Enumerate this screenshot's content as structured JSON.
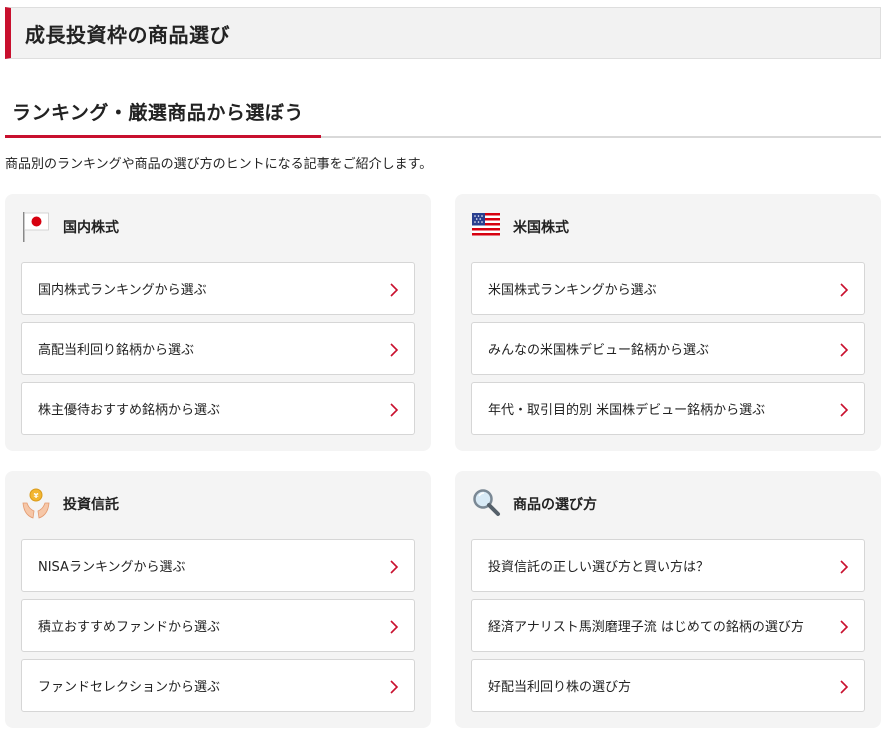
{
  "page_title": "成長投資枠の商品選び",
  "section": {
    "heading": "ランキング・厳選商品から選ぼう",
    "intro": "商品別のランキングや商品の選び方のヒントになる記事をご紹介します。"
  },
  "colors": {
    "accent": "#c8102e",
    "card_bg": "#f4f4f4"
  },
  "cards": [
    {
      "icon": "japan-flag-icon",
      "title": "国内株式",
      "links": [
        "国内株式ランキングから選ぶ",
        "高配当利回り銘柄から選ぶ",
        "株主優待おすすめ銘柄から選ぶ"
      ]
    },
    {
      "icon": "us-flag-icon",
      "title": "米国株式",
      "links": [
        "米国株式ランキングから選ぶ",
        "みんなの米国株デビュー銘柄から選ぶ",
        "年代・取引目的別 米国株デビュー銘柄から選ぶ"
      ]
    },
    {
      "icon": "hands-coin-icon",
      "title": "投資信託",
      "links": [
        "NISAランキングから選ぶ",
        "積立おすすめファンドから選ぶ",
        "ファンドセレクションから選ぶ"
      ]
    },
    {
      "icon": "magnifier-icon",
      "title": "商品の選び方",
      "links": [
        "投資信託の正しい選び方と買い方は？",
        "経済アナリスト馬渕磨理子流 はじめての銘柄の選び方",
        "好配当利回り株の選び方"
      ]
    }
  ]
}
